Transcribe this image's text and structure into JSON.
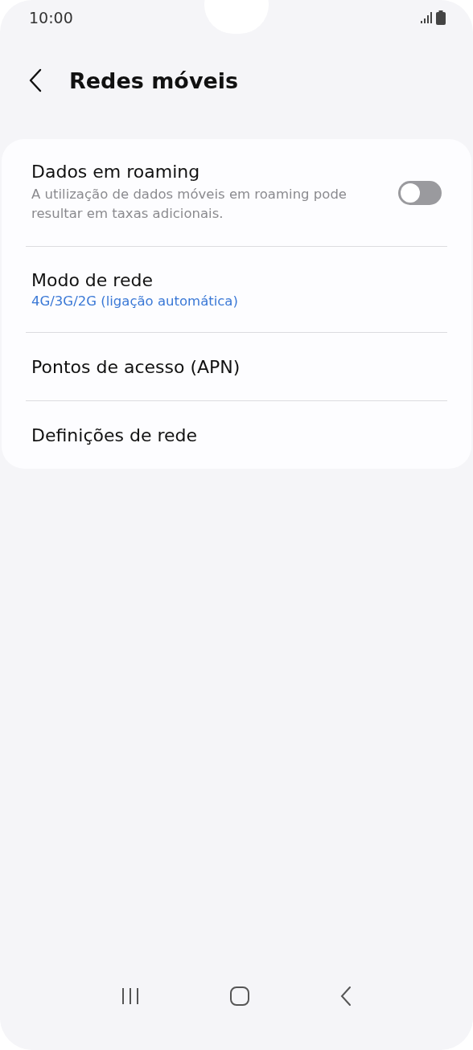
{
  "status_bar": {
    "time": "10:00"
  },
  "header": {
    "title": "Redes móveis"
  },
  "settings": [
    {
      "kind": "toggle",
      "title": "Dados em roaming",
      "subtitle": "A utilização de dados móveis em roaming pode resultar em taxas adicionais.",
      "on": false
    },
    {
      "kind": "value",
      "title": "Modo de rede",
      "value": "4G/3G/2G (ligação automática)"
    },
    {
      "kind": "plain",
      "title": "Pontos de acesso (APN)"
    },
    {
      "kind": "plain",
      "title": "Definições de rede"
    }
  ]
}
